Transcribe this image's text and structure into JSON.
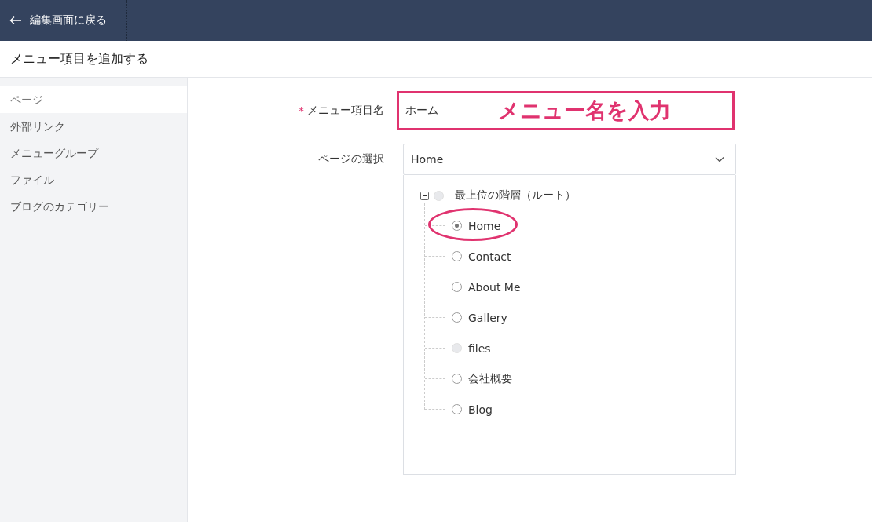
{
  "header": {
    "back_label": "編集画面に戻る"
  },
  "page_title": "メニュー項目を追加する",
  "sidebar": {
    "items": [
      {
        "label": "ページ",
        "selected": true
      },
      {
        "label": "外部リンク",
        "selected": false
      },
      {
        "label": "メニューグループ",
        "selected": false
      },
      {
        "label": "ファイル",
        "selected": false
      },
      {
        "label": "ブログのカテゴリー",
        "selected": false
      }
    ]
  },
  "form": {
    "name_field": {
      "label": "メニュー項目名",
      "required_mark": "*",
      "value": "ホーム",
      "highlighted": true,
      "annotation": "メニュー名を入力"
    },
    "page_select": {
      "label": "ページの選択",
      "value": "Home",
      "expanded": true
    },
    "tree": {
      "label": "最上位の階層（ルート）",
      "expanded": true,
      "disabled": true,
      "selected": false,
      "children": [
        {
          "label": "Home",
          "selected": true,
          "disabled": false,
          "circled": true
        },
        {
          "label": "Contact",
          "selected": false,
          "disabled": false,
          "circled": false
        },
        {
          "label": "About Me",
          "selected": false,
          "disabled": false,
          "circled": false
        },
        {
          "label": "Gallery",
          "selected": false,
          "disabled": false,
          "circled": false
        },
        {
          "label": "files",
          "selected": false,
          "disabled": true,
          "circled": false
        },
        {
          "label": "会社概要",
          "selected": false,
          "disabled": false,
          "circled": false
        },
        {
          "label": "Blog",
          "selected": false,
          "disabled": false,
          "circled": false
        }
      ]
    }
  }
}
